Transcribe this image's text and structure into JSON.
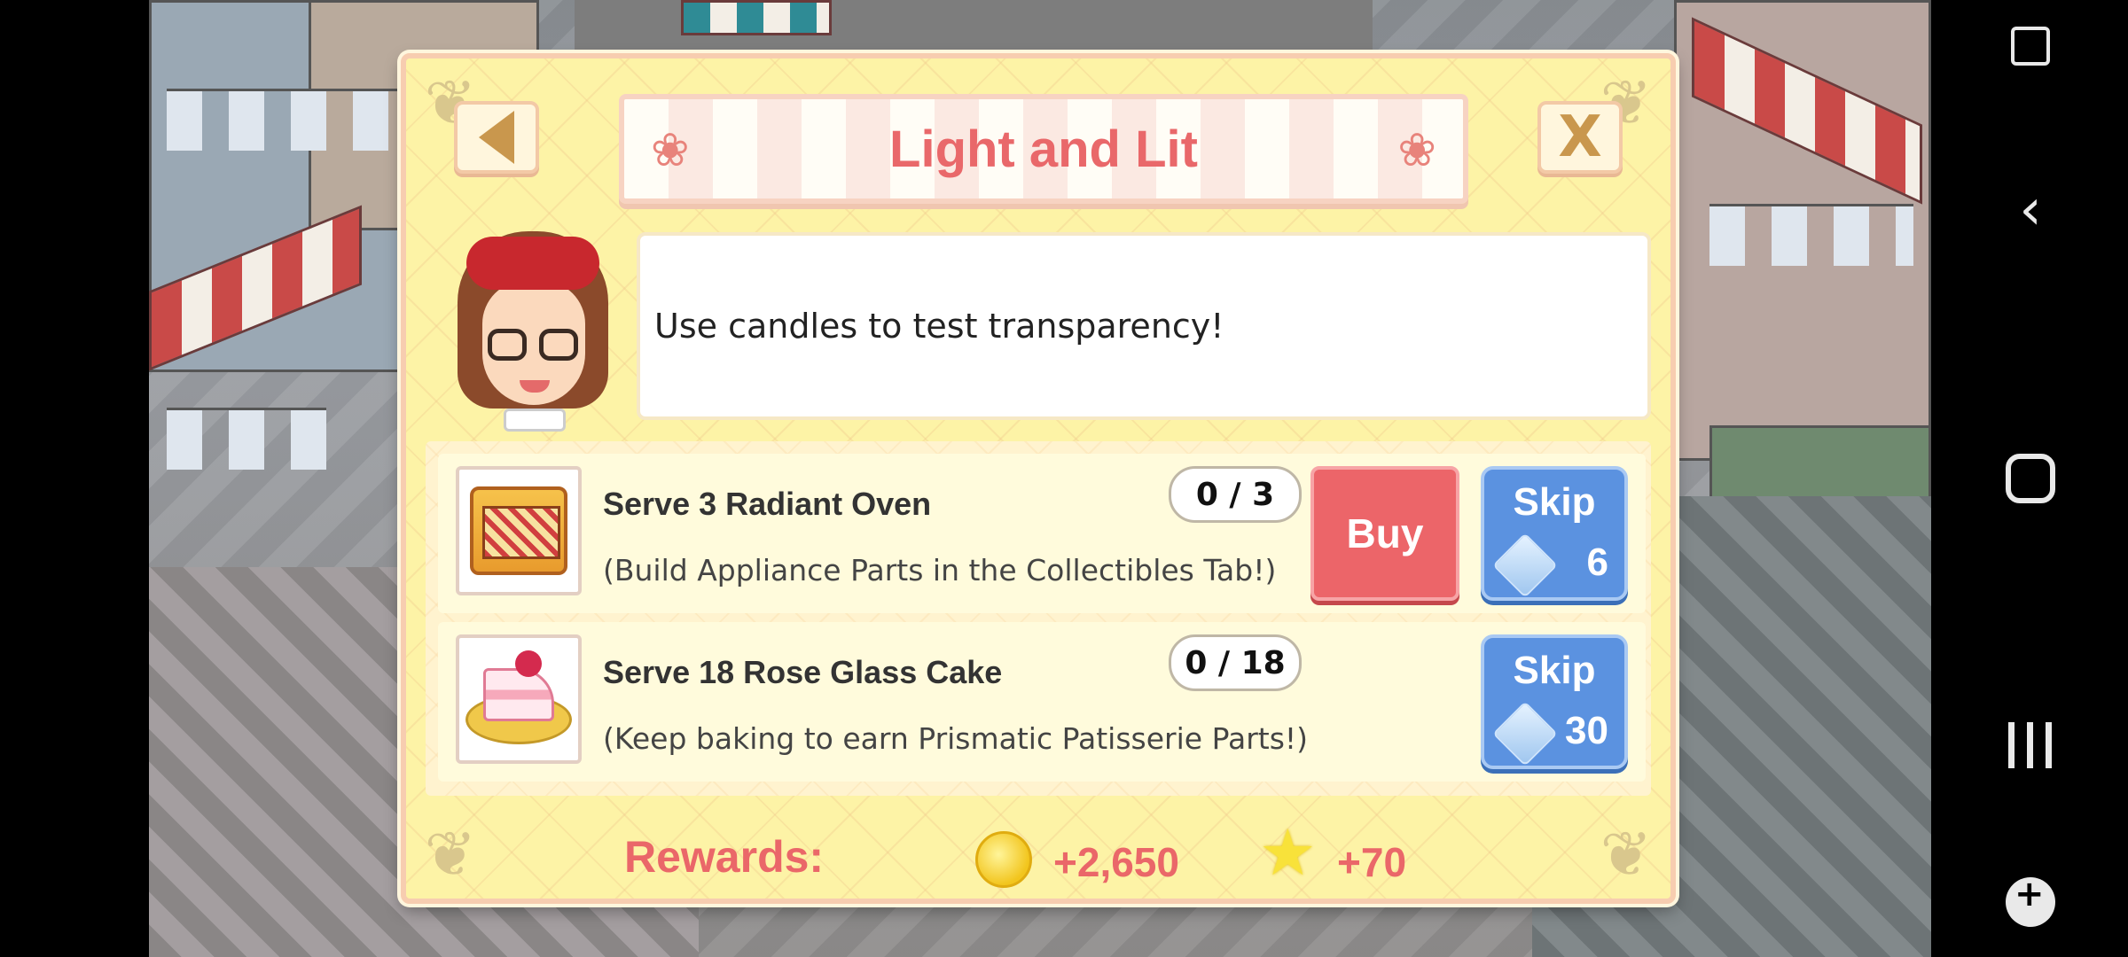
{
  "dialog": {
    "title": "Light and Lit",
    "speech": "Use candles to test transparency!",
    "tasks": [
      {
        "title": "Serve 3 Radiant Oven",
        "description": "(Build Appliance Parts in the Collectibles Tab!)",
        "progress": "0 / 3",
        "buy_label": "Buy",
        "skip_label": "Skip",
        "skip_cost": "6",
        "icon": "radiant-oven-icon"
      },
      {
        "title": "Serve 18 Rose Glass Cake",
        "description": "(Keep baking to earn Prismatic Patisserie Parts!)",
        "progress": "0 / 18",
        "skip_label": "Skip",
        "skip_cost": "30",
        "icon": "rose-glass-cake-icon"
      }
    ],
    "rewards": {
      "label": "Rewards:",
      "coins": "+2,650",
      "stars": "+70"
    }
  },
  "colors": {
    "title": "#e9686a",
    "buy_button": "#ec6569",
    "skip_button": "#5b92e0",
    "dialog_bg": "#fdf3a6"
  }
}
